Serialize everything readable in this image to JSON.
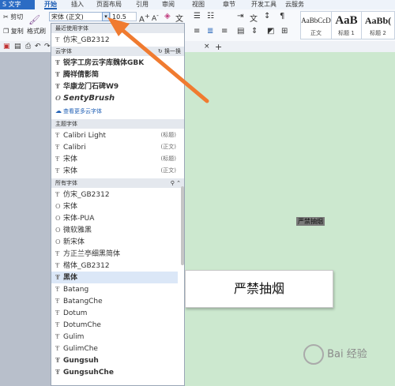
{
  "tabs": {
    "wps": "S 文字",
    "items": [
      "开始",
      "插入",
      "页面布局",
      "引用",
      "审阅",
      "视图",
      "章节",
      "开发工具",
      "云服务"
    ]
  },
  "toolbar": {
    "cut": "剪切",
    "copy": "复制",
    "format_painter": "格式刷",
    "font_value": "宋体 (正文)",
    "size_value": "10.5",
    "styles": [
      {
        "sample": "AaBbCcD",
        "name": "正文"
      },
      {
        "sample": "AaB",
        "name": "标题 1"
      },
      {
        "sample": "AaBb(",
        "name": "标题 2"
      }
    ]
  },
  "dropdown": {
    "recent_header": "最近使用字体",
    "recent": [
      "仿宋_GB2312"
    ],
    "cloud_header": "云字体",
    "cloud_swap": "换一换",
    "cloud": [
      "锐字工房云字库魏体GBK",
      "腾祥倩影简",
      "华康龙门石碑W9",
      "SentyBrush"
    ],
    "cloud_more": "查看更多云字体",
    "theme_header": "主题字体",
    "theme": [
      {
        "name": "Calibri Light",
        "tag": "(标题)"
      },
      {
        "name": "Calibri",
        "tag": "(正文)"
      },
      {
        "name": "宋体",
        "tag": "(标题)"
      },
      {
        "name": "宋体",
        "tag": "(正文)"
      }
    ],
    "all_header": "所有字体",
    "all": [
      "仿宋_GB2312",
      "宋体",
      "宋体-PUA",
      "微软雅黑",
      "新宋体",
      "方正兰亭细黑简体",
      "楷体_GB2312",
      "黑体",
      "Batang",
      "BatangChe",
      "Dotum",
      "DotumChe",
      "Gulim",
      "GulimChe",
      "Gungsuh",
      "GungsuhChe"
    ]
  },
  "document": {
    "selected_text": "严禁抽烟",
    "textbox_text": "严禁抽烟"
  },
  "watermark": "Bai 经验",
  "colors": {
    "accent": "#1f5fb5",
    "page": "#cce8cf",
    "arrow": "#f07b30"
  }
}
